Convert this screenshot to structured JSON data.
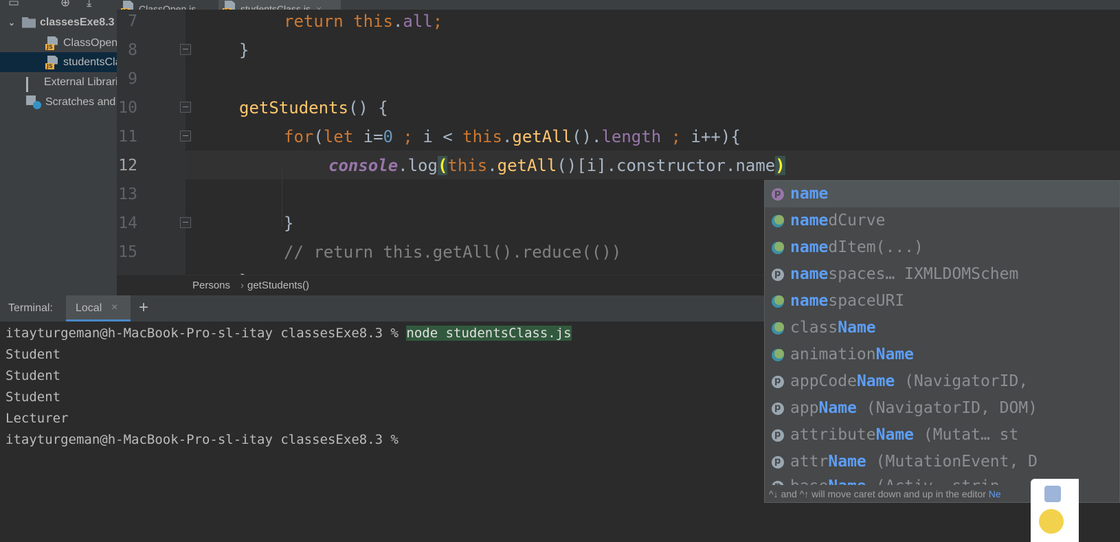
{
  "sidebar": {
    "tree": [
      {
        "label": "classesExe8.3",
        "type": "folder"
      },
      {
        "label": "ClassOpen.js",
        "type": "js"
      },
      {
        "label": "studentsClass.js",
        "type": "js",
        "selected": true
      },
      {
        "label": "External Libraries",
        "type": "lib"
      },
      {
        "label": "Scratches and Consoles",
        "type": "scratch"
      }
    ]
  },
  "tabs": [
    {
      "label": "ClassOpen.js",
      "active": false
    },
    {
      "label": "studentsClass.js",
      "active": true
    }
  ],
  "editor": {
    "line_numbers": [
      "7",
      "8",
      "9",
      "10",
      "11",
      "12",
      "13",
      "14",
      "15"
    ],
    "current_line": "12",
    "code": {
      "l7": {
        "kw": "return",
        "this": "this",
        "prop": "all",
        "end": ";"
      },
      "l8": "}",
      "l10": {
        "fn": "getStudents",
        "rest": "() {"
      },
      "l11": {
        "for": "for",
        "open": "(",
        "let": "let",
        "i0": " i=",
        "zero": "0",
        "semi1": " ; ",
        "i_lt": "i < ",
        "this": "this",
        "dot1": ".",
        "getAll": "getAll",
        "paren": "().",
        "length": "length",
        "semi2": " ; ",
        "end": "i++){"
      },
      "l12": {
        "console": "console",
        "log": ".log",
        "open": "(",
        "this": "this",
        "dot": ".",
        "getAll": "getAll",
        "rest": "()[i].constructor.name",
        "close": ")"
      },
      "l14": "}",
      "l15": "// return this.getAll().reduce(())"
    }
  },
  "breadcrumb": {
    "class": "Persons",
    "method": "getStudents()"
  },
  "terminal": {
    "title": "Terminal:",
    "tab": "Local",
    "lines": {
      "prompt1": "itayturgeman@h-MacBook-Pro-sl-itay classesExe8.3 % ",
      "command": "node studentsClass.js",
      "out1": "Student",
      "out2": "Student",
      "out3": "Student",
      "out4": "Lecturer",
      "prompt2": "itayturgeman@h-MacBook-Pro-sl-itay classesExe8.3 %"
    }
  },
  "completion": {
    "items": [
      {
        "icon": "property",
        "pre": "",
        "match": "name",
        "post": "",
        "selected": true
      },
      {
        "icon": "field",
        "pre": "",
        "match": "name",
        "post": "dCurve"
      },
      {
        "icon": "field",
        "pre": "",
        "match": "name",
        "post": "dItem(...)"
      },
      {
        "icon": "property",
        "pre": "",
        "match": "name",
        "post": "spaces…   IXMLDOMSchem"
      },
      {
        "icon": "field",
        "pre": "",
        "match": "name",
        "post": "spaceURI"
      },
      {
        "icon": "field",
        "pre": "class",
        "match": "Name",
        "post": ""
      },
      {
        "icon": "field",
        "pre": "animation",
        "match": "Name",
        "post": ""
      },
      {
        "icon": "property",
        "pre": "appCode",
        "match": "Name",
        "post": " (NavigatorID, "
      },
      {
        "icon": "property",
        "pre": "app",
        "match": "Name",
        "post": " (NavigatorID, DOM)"
      },
      {
        "icon": "property",
        "pre": "attribute",
        "match": "Name",
        "post": " (Mutat…   st"
      },
      {
        "icon": "property",
        "pre": "attr",
        "match": "Name",
        "post": " (MutationEvent, D"
      },
      {
        "icon": "property",
        "pre": "base",
        "match": "Name",
        "post": " (Activ…   strin"
      }
    ],
    "footer": "^↓ and ^↑ will move caret down and up in the editor",
    "footer_link": "Ne"
  },
  "colors": {
    "keyword": "#cc7832",
    "function": "#ffc66d",
    "number": "#6897bb",
    "property": "#9876aa",
    "completion_match": "#5d9ef6",
    "command_highlight": "#32593d"
  }
}
